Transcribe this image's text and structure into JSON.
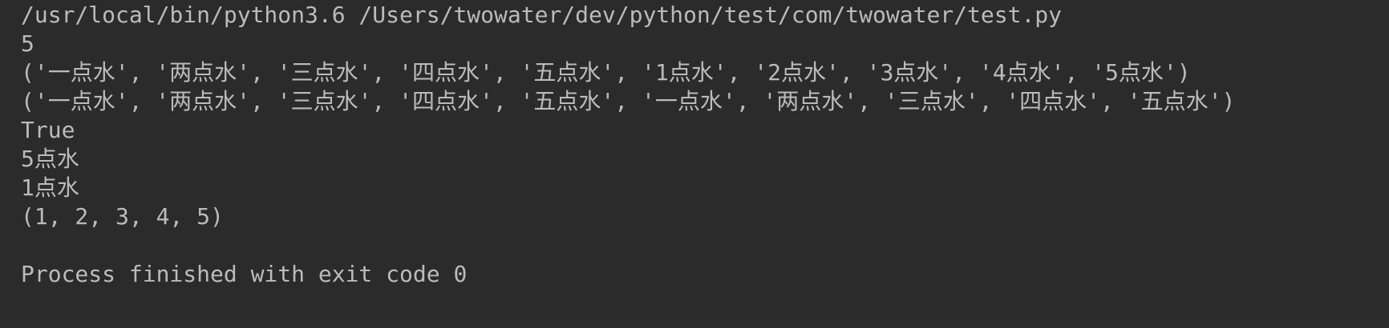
{
  "console": {
    "command_line": "/usr/local/bin/python3.6 /Users/twowater/dev/python/test/com/twowater/test.py",
    "output_lines": [
      "5",
      "('一点水', '两点水', '三点水', '四点水', '五点水', '1点水', '2点水', '3点水', '4点水', '5点水')",
      "('一点水', '两点水', '三点水', '四点水', '五点水', '一点水', '两点水', '三点水', '四点水', '五点水')",
      "True",
      "5点水",
      "1点水",
      "(1, 2, 3, 4, 5)"
    ],
    "exit_message": "Process finished with exit code 0"
  },
  "colors": {
    "background": "#2b2b2b",
    "text": "#bbbbbb"
  }
}
